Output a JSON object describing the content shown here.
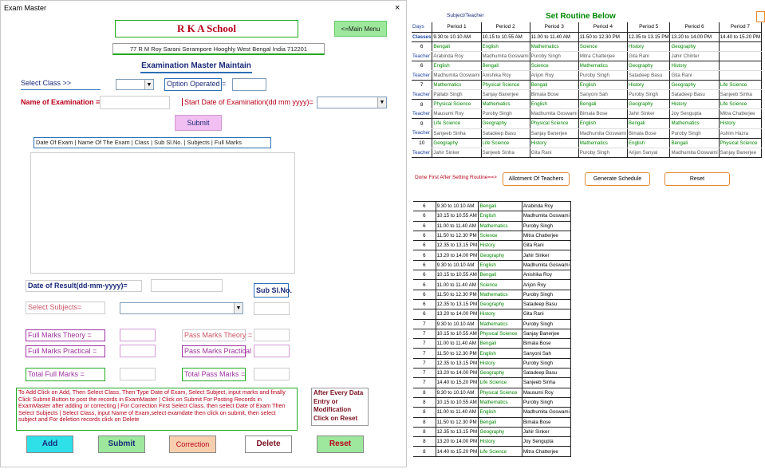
{
  "window": {
    "title": "Exam Master",
    "close": "×"
  },
  "form": {
    "school_name": "R K A School",
    "main_menu": "<=Main Menu",
    "address": "77 R M Roy Sarani Serampore Hooghly West Bengal India 712201",
    "section_title": "Examination Master Maintain",
    "select_class": "Select Class >>",
    "option_operated": "Option Operated =",
    "name_of_exam": "Name of Examination =",
    "start_date": "Start Date of Examination(dd mm yyyy)=",
    "submit_top": "Submit",
    "grid_header": "Date Of Exam | Name Of The Exam | Class | Sub Sl.No. |          Subjects          | Full Marks",
    "date_of_result": "Date of Result(dd-mm-yyyy)=",
    "sub_slno": "Sub Sl.No.",
    "select_subjects": "Select Subjects=",
    "full_marks_theory": "Full Marks Theory =",
    "pass_marks_theory": "Pass Marks Theory =",
    "full_marks_practical": "Full Marks Practical =",
    "pass_marks_practical": "Pass Marks Practical =",
    "total_full_marks": "Total Full Marks =",
    "total_pass_marks": "Total Pass Marks =",
    "instructions": "To Add Click on Add, Then Select Class, Then Type Date of Exam, Select Subject, input marks and finally Click Submit Button to post the records in ExamMaster | Click on Submit  For Posting Records in ExamMaster after adding or correcting  |  For Correction First Select  Class,  then select Date of Exam Then Select Subjects |  Select Class, input Name of Exam,select examdate then click on submit, then select subject and  For deletion records click on Delete",
    "side_note": "After Every Data Entry or Modification Click on Reset",
    "buttons": {
      "add": "Add",
      "submit": "Submit",
      "correction": "Correction",
      "delete": "Delete",
      "reset": "Reset"
    }
  },
  "routine": {
    "subject_teacher": "Subject/Teacher",
    "title": "Set Routine Below",
    "col_days": "Days",
    "periods": [
      "Period 1",
      "Period 2",
      "Period 3",
      "Period 4",
      "Period 5",
      "Period 6",
      "Period 7"
    ],
    "classes_label": "Classes",
    "times": [
      "9.30 to 10.10 AM",
      "10.15 to 10.55 AM",
      "11.00 to 11.40 AM",
      "11.50 to 12.30 PM",
      "12.35 to 13.15 PM",
      "13.20 to 14.00 PM",
      "14.40 to 15.20 PM"
    ],
    "rows": [
      {
        "cls": "6",
        "subjects": [
          "Bengali",
          "English",
          "Mathematics",
          "Science",
          "History",
          "Geography",
          ""
        ],
        "teachers": [
          "Arabinda Roy",
          "Madhumita Goswami",
          "Puroby Singh",
          "Mitra Chatterjee",
          "Gita Rani",
          "Jahir Chinter",
          ""
        ]
      },
      {
        "cls": "6",
        "subjects": [
          "English",
          "Bengali",
          "Science",
          "Mathematics",
          "Geography",
          "History",
          ""
        ],
        "teachers": [
          "Madhumita Goswami",
          "Anishika Roy",
          "Arijon Roy",
          "Puroby Singh",
          "Satadeep Basu",
          "Gita Rani",
          ""
        ]
      },
      {
        "cls": "7",
        "subjects": [
          "Mathematics",
          "Physical Science",
          "Bengali",
          "English",
          "History",
          "Geography",
          "Life Science"
        ],
        "teachers": [
          "Pallabi Singh",
          "Sanjay Banerjee",
          "Bimala Bose",
          "Sanyoni Sah",
          "Puroby Singh",
          "Satadeep Basu",
          "Sanjeeb Sinha"
        ]
      },
      {
        "cls": "8",
        "subjects": [
          "Physical Science",
          "Mathematics",
          "English",
          "Bengali",
          "Geography",
          "History",
          "Life Science"
        ],
        "teachers": [
          "Mausumi Roy",
          "Puroby Singh",
          "Madhumita Goswami",
          "Bimala Bose",
          "Jahir Sinker",
          "Joy Sengupta",
          "Mitra Chatterjee"
        ]
      },
      {
        "cls": "9",
        "subjects": [
          "Life Science",
          "Geography",
          "Physical Science",
          "English",
          "Bengali",
          "Mathematics",
          "History"
        ],
        "teachers": [
          "Sanjeeb Sinha",
          "Satadeep Basu",
          "Sanjay Banerjee",
          "Madhumita Goswami",
          "Bimala Bose",
          "Puroby Singh",
          "Ashim Hazra"
        ]
      },
      {
        "cls": "10",
        "subjects": [
          "Geography",
          "Life Science",
          "History",
          "Mathematics",
          "English",
          "Bengali",
          "Physical Science"
        ],
        "teachers": [
          "Jahir Sinker",
          "Sanjeeb Sinha",
          "Gita Rani",
          "Puroby Singh",
          "Arijon Sanyal",
          "Madhumita Goswami",
          "Sanjay Banerjee"
        ]
      }
    ],
    "teacher_label": "Teacher",
    "prompt": "Done First After Setting Routine==>",
    "btn_allotment": "Allotment Of Teachers",
    "btn_generate": "Generate Schedule",
    "btn_reset": "Reset",
    "schedule": [
      [
        "6",
        "9.30 to 10.10 AM",
        "Bengali",
        "Arabinda Roy"
      ],
      [
        "6",
        "10.15 to 10.55 AM",
        "English",
        "Madhumita Goswami"
      ],
      [
        "6",
        "11.00 to 11.40 AM",
        "Mathematics",
        "Puroby Singh"
      ],
      [
        "6",
        "11.50 to 12.30 PM",
        "Science",
        "Mitra Chatterjee"
      ],
      [
        "6",
        "12.35 to 13.15 PM",
        "History",
        "Gita Rani"
      ],
      [
        "6",
        "13.20 to 14.00 PM",
        "Geography",
        "Jahir Sinker"
      ],
      [
        "6",
        "9.30 to 10.10 AM",
        "English",
        "Madhumita Goswami"
      ],
      [
        "6",
        "10.15 to 10.55 AM",
        "Bengali",
        "Anishika Roy"
      ],
      [
        "6",
        "11.00 to 11.40 AM",
        "Science",
        "Arijon Roy"
      ],
      [
        "6",
        "11.50 to 12.30 PM",
        "Mathematics",
        "Puroby Singh"
      ],
      [
        "6",
        "12.35 to 13.15 PM",
        "Geography",
        "Satadeep Basu"
      ],
      [
        "6",
        "13.20 to 14.00 PM",
        "History",
        "Gita Rani"
      ],
      [
        "7",
        "9.30 to 10.10 AM",
        "Mathematics",
        "Puroby Singh"
      ],
      [
        "7",
        "10.15 to 10.55 AM",
        "Physical Science",
        "Sanjay Banerjee"
      ],
      [
        "7",
        "11.00 to 11.40 AM",
        "Bengali",
        "Bimala Bose"
      ],
      [
        "7",
        "11.50 to 12.30 PM",
        "English",
        "Sanyoni Sah"
      ],
      [
        "7",
        "12.35 to 13.15 PM",
        "History",
        "Puroby Singh"
      ],
      [
        "7",
        "13.20 to 14.00 PM",
        "Geography",
        "Satadeep Basu"
      ],
      [
        "7",
        "14.40 to 15.20 PM",
        "Life Science",
        "Sanjeeb Sinha"
      ],
      [
        "8",
        "9.30 to 10.10 AM",
        "Physical Science",
        "Mausumi Roy"
      ],
      [
        "8",
        "10.15 to 10.55 AM",
        "Mathematics",
        "Puroby Singh"
      ],
      [
        "8",
        "11.00 to 11.40 AM",
        "English",
        "Madhumita Goswami"
      ],
      [
        "8",
        "11.50 to 12.30 PM",
        "Bengali",
        "Bimala Bose"
      ],
      [
        "8",
        "12.35 to 13.15 PM",
        "Geography",
        "Jahir Sinker"
      ],
      [
        "8",
        "13.20 to 14.00 PM",
        "History",
        "Joy Sengupta"
      ],
      [
        "8",
        "14.40 to 15.20 PM",
        "Life Science",
        "Mitra Chatterjee"
      ]
    ]
  }
}
